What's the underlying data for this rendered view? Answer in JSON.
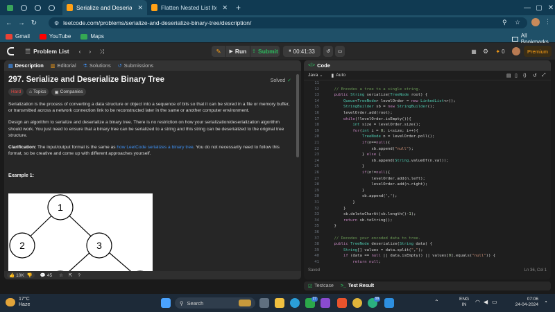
{
  "browser": {
    "tabs": [
      {
        "title": "Serialize and Deserialize Binar",
        "active": true
      },
      {
        "title": "Flatten Nested List Iterator - L",
        "active": false
      }
    ],
    "url": "leetcode.com/problems/serialize-and-deserialize-binary-tree/description/",
    "bookmarks": [
      {
        "label": "Gmail"
      },
      {
        "label": "YouTube"
      },
      {
        "label": "Maps"
      }
    ],
    "all_bookmarks_label": "All Bookmarks"
  },
  "nav": {
    "problem_list": "Problem List",
    "run_label": "Run",
    "submit_label": "Submit",
    "timer": "00:41:33",
    "coins": "0",
    "premium_label": "Premium"
  },
  "left": {
    "tabs": [
      "Description",
      "Editorial",
      "Solutions",
      "Submissions"
    ],
    "title": "297. Serialize and Deserialize Binary Tree",
    "status": "Solved",
    "tags": {
      "difficulty": "Hard",
      "topics": "Topics",
      "companies": "Companies"
    },
    "para1": "Serialization is the process of converting a data structure or object into a sequence of bits so that it can be stored in a file or memory buffer, or transmitted across a network connection link to be reconstructed later in the same or another computer environment.",
    "para2": "Design an algorithm to serialize and deserialize a binary tree. There is no restriction on how your serialization/deserialization algorithm should work. You just need to ensure that a binary tree can be serialized to a string and this string can be deserialized to the original tree structure.",
    "clar_label": "Clarification:",
    "clar_text_a": " The input/output format is the same as ",
    "clar_link": "how LeetCode serializes a binary tree",
    "clar_text_b": ". You do not necessarily need to follow this format, so be creative and come up with different approaches yourself.",
    "example_label": "Example 1:",
    "tree_nodes": [
      "1",
      "2",
      "3"
    ],
    "likes": "10K",
    "comments": "45"
  },
  "right": {
    "header": "Code",
    "language": "Java",
    "mode": "Auto",
    "status_left": "Saved",
    "status_right": "Ln 36, Col 1",
    "bottom_tabs": [
      "Testcase",
      "Test Result"
    ],
    "lines": [
      {
        "n": "11",
        "t": ""
      },
      {
        "n": "12",
        "t": "    // Encodes a tree to a single string."
      },
      {
        "n": "13",
        "t": "    public String serialize(TreeNode root) {"
      },
      {
        "n": "14",
        "t": "        Queue<TreeNode> levelOrder = new LinkedList<>();"
      },
      {
        "n": "15",
        "t": "        StringBuilder sb = new StringBuilder();"
      },
      {
        "n": "16",
        "t": "        levelOrder.add(root);"
      },
      {
        "n": "17",
        "t": "        while(!levelOrder.isEmpty()){"
      },
      {
        "n": "18",
        "t": "            int size = levelOrder.size();"
      },
      {
        "n": "19",
        "t": "            for(int i = 0; i<size; i++){"
      },
      {
        "n": "20",
        "t": "                TreeNode n = levelOrder.poll();"
      },
      {
        "n": "21",
        "t": "                if(n==null){"
      },
      {
        "n": "22",
        "t": "                    sb.append(\"null\");"
      },
      {
        "n": "23",
        "t": "                } else {"
      },
      {
        "n": "24",
        "t": "                    sb.append(String.valueOf(n.val));"
      },
      {
        "n": "25",
        "t": "                }"
      },
      {
        "n": "26",
        "t": "                if(n!=null){"
      },
      {
        "n": "27",
        "t": "                    levelOrder.add(n.left);"
      },
      {
        "n": "28",
        "t": "                    levelOrder.add(n.right);"
      },
      {
        "n": "29",
        "t": "                }"
      },
      {
        "n": "30",
        "t": "                sb.append(',');"
      },
      {
        "n": "31",
        "t": "            }"
      },
      {
        "n": "32",
        "t": "        }"
      },
      {
        "n": "33",
        "t": "        sb.deleteCharAt(sb.length()-1);"
      },
      {
        "n": "34",
        "t": "        return sb.toString();"
      },
      {
        "n": "35",
        "t": "    }"
      },
      {
        "n": "36",
        "t": ""
      },
      {
        "n": "37",
        "t": "    // Decodes your encoded data to tree."
      },
      {
        "n": "38",
        "t": "    public TreeNode deserialize(String data) {"
      },
      {
        "n": "39",
        "t": "        String[] values = data.split(\",\");"
      },
      {
        "n": "40",
        "t": "        if (data == null || data.isEmpty() || values[0].equals(\"null\")) {"
      },
      {
        "n": "41",
        "t": "            return null;"
      }
    ]
  },
  "taskbar": {
    "temp": "17°C",
    "weather": "Haze",
    "search_placeholder": "Search",
    "lang_top": "ENG",
    "lang_bottom": "IN",
    "time": "07:06",
    "date": "24-04-2024",
    "badge_a": "27",
    "badge_b": "99"
  },
  "colors": {
    "accent_orange": "#ffa116",
    "hard_red": "#ef4743",
    "solved_green": "#2cbb5d",
    "link_blue": "#3e8ff0"
  }
}
